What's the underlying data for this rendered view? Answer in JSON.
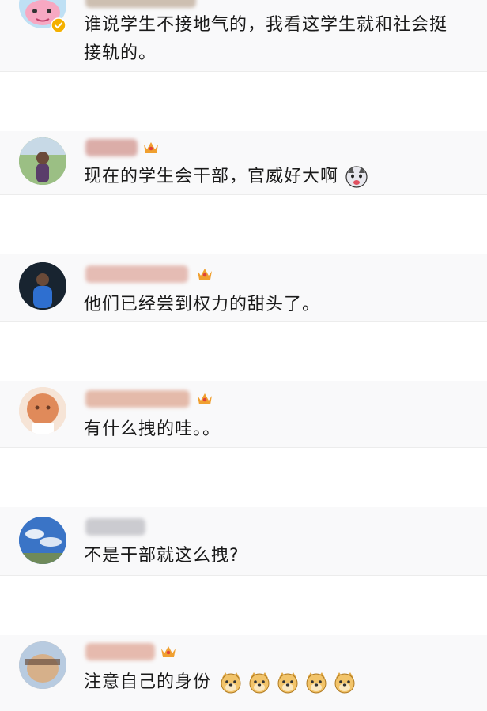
{
  "comments": [
    {
      "text": "谁说学生不接地气的，我看这学生就和社会挺接轨的。",
      "avatar": "peppa-pig-avatar",
      "verified": true
    },
    {
      "text": "现在的学生会干部，官威好大啊",
      "avatar": "outdoor-person-avatar",
      "emoji": "husky-emoji"
    },
    {
      "text": "他们已经尝到权力的甜头了。",
      "avatar": "person-blue-shirt-avatar"
    },
    {
      "text": "有什么拽的哇。。",
      "avatar": "cartoon-face-avatar"
    },
    {
      "text": "不是干部就这么拽?",
      "avatar": "blue-sky-avatar"
    },
    {
      "text": "注意自己的身份",
      "avatar": "blurred-face-avatar",
      "emoji": "doge-emoji"
    }
  ],
  "colors": {
    "crown": "#f0a030",
    "verified": "#f4b000"
  }
}
